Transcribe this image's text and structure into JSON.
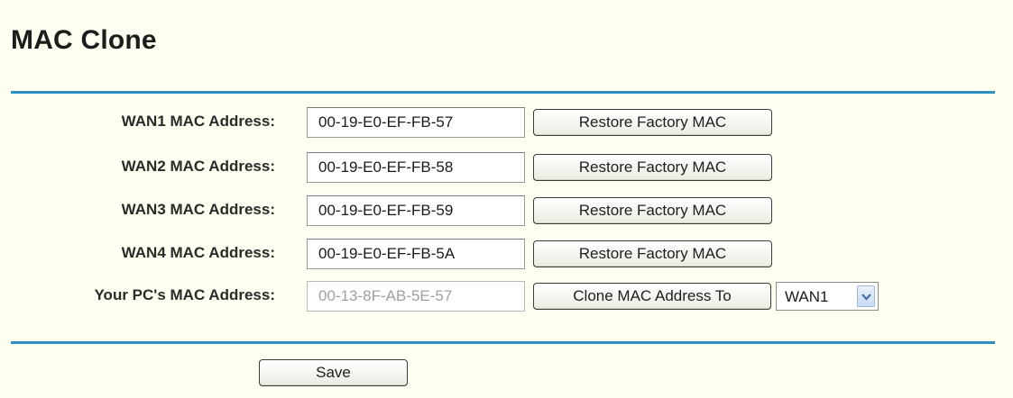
{
  "page": {
    "title": "MAC Clone"
  },
  "rows": [
    {
      "label": "WAN1 MAC Address:",
      "value": "00-19-E0-EF-FB-57",
      "button": "Restore Factory MAC"
    },
    {
      "label": "WAN2 MAC Address:",
      "value": "00-19-E0-EF-FB-58",
      "button": "Restore Factory MAC"
    },
    {
      "label": "WAN3 MAC Address:",
      "value": "00-19-E0-EF-FB-59",
      "button": "Restore Factory MAC"
    },
    {
      "label": "WAN4 MAC Address:",
      "value": "00-19-E0-EF-FB-5A",
      "button": "Restore Factory MAC"
    }
  ],
  "pc": {
    "label": "Your PC's MAC Address:",
    "value": "00-13-8F-AB-5E-57",
    "button": "Clone MAC Address To",
    "target_selected": "WAN1"
  },
  "actions": {
    "save_label": "Save"
  },
  "colors": {
    "background": "#fffff1",
    "rule": "#2d91c4",
    "readonly_text": "#a0a0a0"
  }
}
